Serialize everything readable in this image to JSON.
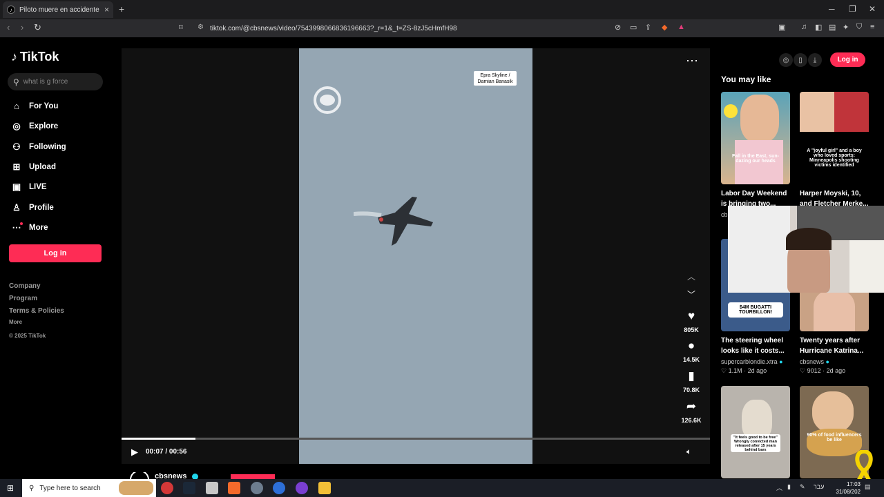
{
  "browser": {
    "tab_title": "Piloto muere en accidente de ca",
    "tab_favicon": "tiktok-icon",
    "url": "tiktok.com/@cbsnews/video/7543998066836196663?_r=1&_t=ZS-8zJ5cHmfH98",
    "new_tab": "+",
    "tab_close": "×"
  },
  "sidebar": {
    "logo_text": "TikTok",
    "search_placeholder": "what is g force",
    "nav": [
      {
        "label": "For You",
        "icon": "home-icon"
      },
      {
        "label": "Explore",
        "icon": "compass-icon"
      },
      {
        "label": "Following",
        "icon": "user-icon"
      },
      {
        "label": "Upload",
        "icon": "plus-square-icon"
      },
      {
        "label": "LIVE",
        "icon": "live-icon"
      },
      {
        "label": "Profile",
        "icon": "profile-icon"
      },
      {
        "label": "More",
        "icon": "more-icon"
      }
    ],
    "login_label": "Log in",
    "footer": [
      "Company",
      "Program",
      "Terms & Policies",
      "More",
      "© 2025 TikTok"
    ]
  },
  "player": {
    "credit_line1": "Epra Skyline /",
    "credit_line2": "Damian Banasik",
    "actions": [
      {
        "icon": "heart-icon",
        "count": "805K"
      },
      {
        "icon": "comment-icon",
        "count": "14.5K"
      },
      {
        "icon": "bookmark-icon",
        "count": "70.8K"
      },
      {
        "icon": "share-icon",
        "count": "126.6K"
      }
    ],
    "time": "00:07 / 00:56",
    "progress_fraction": 0.125,
    "author": "cbsnews"
  },
  "right_panel": {
    "login_label": "Log in",
    "heading": "You may like",
    "cards": [
      {
        "title": "Labor Day Weekend is bringing two...",
        "author": "cb",
        "likes": "",
        "ago": "",
        "overlay": "Fall in the East, sun-dazing our heads",
        "accent": "#7a5a3e"
      },
      {
        "title": "Harper Moyski, 10, and Fletcher Merke...",
        "author": "",
        "likes": "",
        "ago": "",
        "overlay": "A \"joyful girl\" and a boy who loved sports: Minneapolis shooting victims identified",
        "accent": "#000000"
      },
      {
        "title": "The steering wheel looks like it costs...",
        "author": "supercarblondie.xtra",
        "likes": "1.1M",
        "ago": "2d ago",
        "overlay": "$4M BUGATTI TOURBILLON!",
        "accent": "#3b5b8a"
      },
      {
        "title": "Twenty years after Hurricane Katrina...",
        "author": "cbsnews",
        "likes": "9012",
        "ago": "2d ago",
        "overlay": "",
        "accent": "#c9a285"
      },
      {
        "title": "",
        "author": "",
        "likes": "",
        "ago": "",
        "overlay": "\"It feels good to be free\" Wrongly convicted man released after 15 years behind bars",
        "accent": "#b9b4ad"
      },
      {
        "title": "",
        "author": "",
        "likes": "",
        "ago": "",
        "overlay": "90% of food influencers be like",
        "accent": "#7d6a52"
      }
    ]
  },
  "taskbar": {
    "search_placeholder": "Type here to search",
    "time": "17:03",
    "date": "31/08/202",
    "lang": "עבר"
  }
}
